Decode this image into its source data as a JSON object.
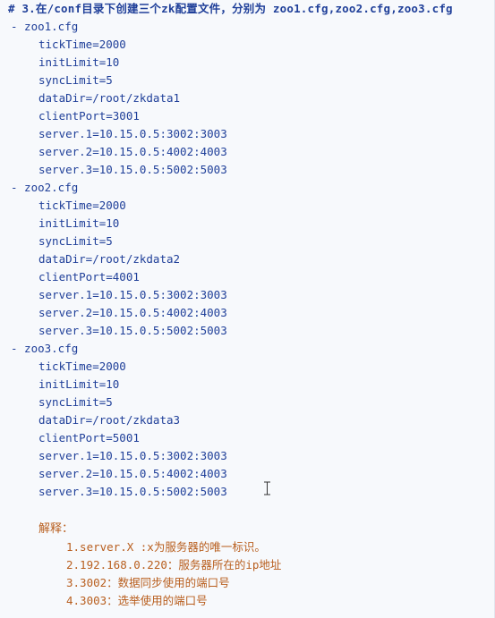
{
  "heading": "# 3.在/conf目录下创建三个zk配置文件，分别为 zoo1.cfg,zoo2.cfg,zoo3.cfg",
  "files": [
    {
      "name": "- zoo1.cfg",
      "lines": [
        "tickTime=2000",
        "initLimit=10",
        "syncLimit=5",
        "dataDir=/root/zkdata1",
        "clientPort=3001",
        "server.1=10.15.0.5:3002:3003",
        "server.2=10.15.0.5:4002:4003",
        "server.3=10.15.0.5:5002:5003"
      ]
    },
    {
      "name": "- zoo2.cfg",
      "lines": [
        "tickTime=2000",
        "initLimit=10",
        "syncLimit=5",
        "dataDir=/root/zkdata2",
        "clientPort=4001",
        "server.1=10.15.0.5:3002:3003",
        "server.2=10.15.0.5:4002:4003",
        "server.3=10.15.0.5:5002:5003"
      ]
    },
    {
      "name": "- zoo3.cfg",
      "lines": [
        "tickTime=2000",
        "initLimit=10",
        "syncLimit=5",
        "dataDir=/root/zkdata3",
        "clientPort=5001",
        "server.1=10.15.0.5:3002:3003",
        "server.2=10.15.0.5:4002:4003",
        "server.3=10.15.0.5:5002:5003"
      ]
    }
  ],
  "notes": {
    "title": "解释：",
    "items": [
      "1.server.X :x为服务器的唯一标识。",
      "2.192.168.0.220：服务器所在的ip地址",
      "3.3002：数据同步使用的端口号",
      "4.3003：选举使用的端口号"
    ]
  },
  "colors": {
    "config_text": "#1f3f99",
    "notes_text": "#b85e1e",
    "background": "#f7f9fc"
  },
  "icons": {
    "cursor": "text-cursor-icon"
  }
}
